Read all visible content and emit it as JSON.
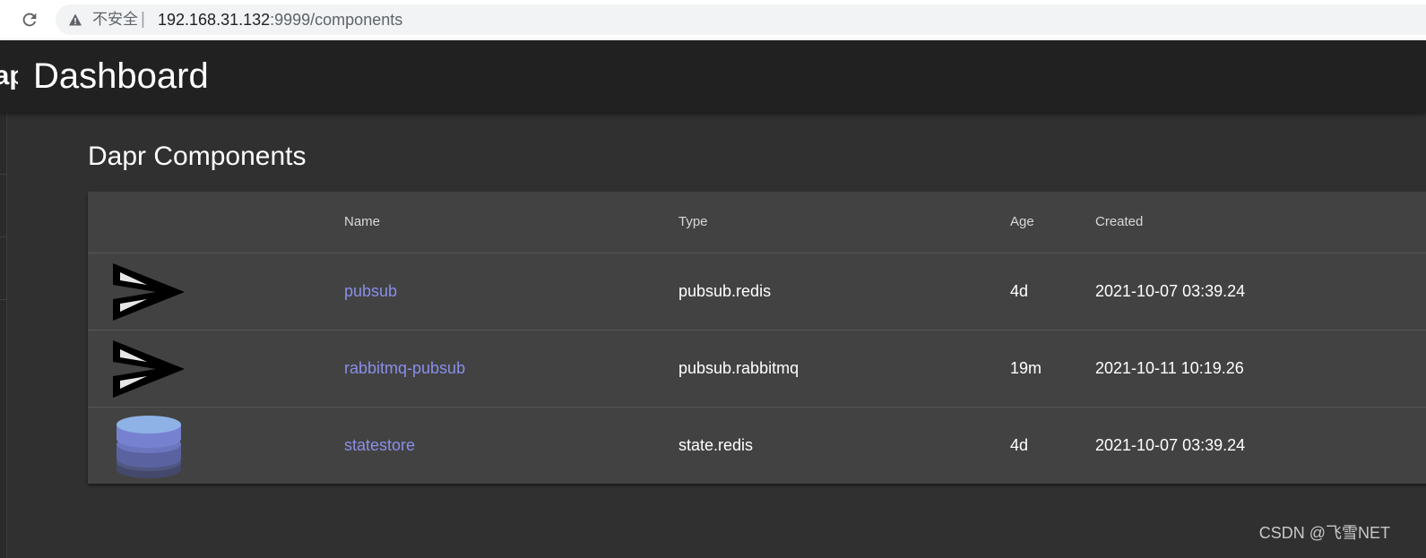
{
  "browser": {
    "security_label": "不安全",
    "url_host": "192.168.31.132",
    "url_rest": ":9999/components"
  },
  "header": {
    "logo_text": "Dapr",
    "title": "Dashboard"
  },
  "page": {
    "title": "Dapr Components"
  },
  "table": {
    "columns": [
      "Name",
      "Type",
      "Age",
      "Created"
    ],
    "rows": [
      {
        "icon": "send-icon",
        "name": "pubsub",
        "type": "pubsub.redis",
        "age": "4d",
        "created": "2021-10-07 03:39.24"
      },
      {
        "icon": "send-icon",
        "name": "rabbitmq-pubsub",
        "type": "pubsub.rabbitmq",
        "age": "19m",
        "created": "2021-10-11 10:19.26"
      },
      {
        "icon": "database-icon",
        "name": "statestore",
        "type": "state.redis",
        "age": "4d",
        "created": "2021-10-07 03:39.24"
      }
    ]
  },
  "watermark": "CSDN @飞雪NET"
}
